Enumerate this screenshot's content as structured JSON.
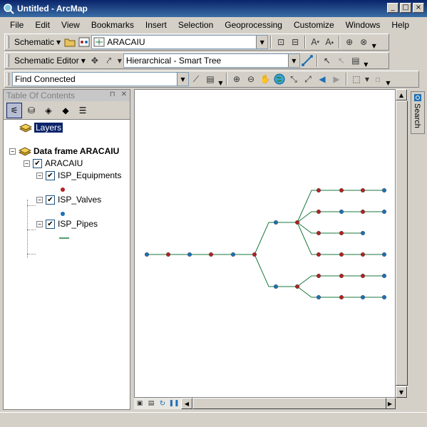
{
  "window": {
    "title": "Untitled - ArcMap",
    "min": "_",
    "max": "□",
    "close": "×"
  },
  "menu": [
    "File",
    "Edit",
    "View",
    "Bookmarks",
    "Insert",
    "Selection",
    "Geoprocessing",
    "Customize",
    "Windows",
    "Help"
  ],
  "toolbar_schematic": {
    "label": "Schematic",
    "dataset": "ARACAIU"
  },
  "toolbar_editor": {
    "label": "Schematic Editor",
    "layout": "Hierarchical - Smart Tree"
  },
  "toolbar_find": {
    "value": "Find Connected"
  },
  "toc": {
    "title": "Table Of Contents",
    "root": "Layers",
    "dataframe": "Data frame ARACAIU",
    "group": "ARACAIU",
    "layers": [
      {
        "name": "ISP_Equipments",
        "symbol": "red-dot"
      },
      {
        "name": "ISP_Valves",
        "symbol": "blue-dot"
      },
      {
        "name": "ISP_Pipes",
        "symbol": "green-line"
      }
    ]
  },
  "search_tab": {
    "label": "Search"
  },
  "colors": {
    "pipe": "#1a7a3c",
    "equipment": "#b22222",
    "valve": "#1f6fb5",
    "selection": "#0a246a"
  }
}
